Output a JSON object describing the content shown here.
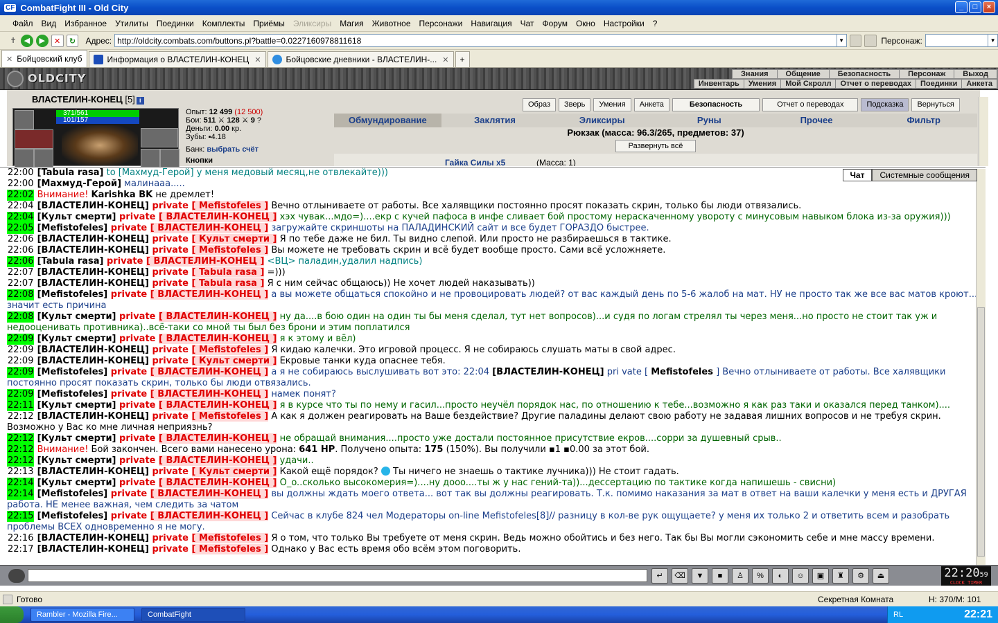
{
  "window": {
    "title": "CombatFight III - Old City",
    "icon": "CF"
  },
  "menu": [
    "Файл",
    "Вид",
    "Избранное",
    "Утилиты",
    "Поединки",
    "Комплекты",
    "Приёмы",
    "Эликсиры",
    "Магия",
    "Животное",
    "Персонажи",
    "Навигация",
    "Чат",
    "Форум",
    "Окно",
    "Настройки",
    "?"
  ],
  "menu_disabled": "Эликсиры",
  "address": {
    "label": "Адрес:",
    "url": "http://oldcity.combats.com/buttons.pl?battle=0.0227160978811618",
    "char_label": "Персонаж:"
  },
  "tabs": [
    {
      "label": "Бойцовский клуб"
    },
    {
      "label": "Информация о ВЛАСТЕЛИН-КОНЕЦ"
    },
    {
      "label": "Бойцовские дневники - ВЛАСТЕЛИН-..."
    }
  ],
  "game": {
    "logo": "OLDCITY",
    "topnav": [
      "Знания",
      "Общение",
      "Безопасность",
      "Персонаж",
      "Выход"
    ],
    "subnav": [
      "Инвентарь",
      "Умения",
      "Мой Скролл",
      "Отчет о переводах",
      "Поединки",
      "Анкета"
    ]
  },
  "character": {
    "name": "ВЛАСТЕЛИН-КОНЕЦ",
    "level": "[5]",
    "hp": "371/561",
    "mp": "101/157",
    "exp_label": "Опыт:",
    "exp": "12 499",
    "exp_next": "(12 500)",
    "fights_label": "Бои:",
    "fights": "511",
    "fights2": "128",
    "fights3": "9",
    "money_label": "Деньги:",
    "money": "0.00",
    "money_unit": "кр.",
    "teeth_label": "Зубы:",
    "teeth": "4.18",
    "bank_label": "Банк:",
    "bank_link": "выбрать счёт",
    "cut_label": "Кнопки"
  },
  "charbuttons": [
    "Образ",
    "Зверь",
    "Умения",
    "Анкета",
    "Безопасность",
    "Отчет о переводах",
    "Подсказка",
    "Вернуться"
  ],
  "invtabs": [
    "Обмундирование",
    "Заклятия",
    "Эликсиры",
    "Руны",
    "Прочее",
    "Фильтр"
  ],
  "backpack": "Рюкзак (масса: 96.3/265, предметов: 37)",
  "expand": "Развернуть всё",
  "item": {
    "name": "Гайка Силы",
    "count": "x5",
    "mass": "(Масса: 1)"
  },
  "chat_tabs": [
    "Чат",
    "Системные сообщения"
  ],
  "chat": [
    {
      "t": "22:00",
      "hl": false,
      "parts": [
        [
          "n",
          "[Tabula rasa]"
        ],
        [
          "to",
          " to [Махмуд-Герой] у меня медовый месяц,не отвлекайте)))"
        ]
      ]
    },
    {
      "t": "22:00",
      "hl": false,
      "parts": [
        [
          "n",
          "[Махмуд-Герой]"
        ],
        [
          "b",
          " малинааа....."
        ]
      ]
    },
    {
      "t": "22:02",
      "hl": true,
      "parts": [
        [
          "w",
          " Внимание! "
        ],
        [
          "n",
          "Karishka BK"
        ],
        [
          "x",
          " не дремлет!"
        ]
      ]
    },
    {
      "t": "22:04",
      "hl": false,
      "parts": [
        [
          "n",
          "[ВЛАСТЕЛИН-КОНЕЦ]"
        ],
        [
          "p",
          " private "
        ],
        [
          "pn",
          "[ Mefistofeles ]"
        ],
        [
          "x",
          " Вечно отлыниваете от работы. Все халявщики постоянно просят показать скрин, только бы люди отвязались."
        ]
      ]
    },
    {
      "t": "22:04",
      "hl": true,
      "parts": [
        [
          "n",
          "[Культ смерти]"
        ],
        [
          "p",
          " private "
        ],
        [
          "pn",
          "[ ВЛАСТЕЛИН-КОНЕЦ ]"
        ],
        [
          "g",
          " хэх чувак...мдо=)....екр с кучей пафоса в инфе сливает бой простому нераскаченному увороту с минусовым навыком блока из-за оружия)))"
        ]
      ]
    },
    {
      "t": "22:05",
      "hl": true,
      "parts": [
        [
          "n",
          "[Mefistofeles]"
        ],
        [
          "p",
          " private "
        ],
        [
          "pn",
          "[ ВЛАСТЕЛИН-КОНЕЦ ]"
        ],
        [
          "b",
          " загружайте скриншоты на ПАЛАДИНСКИЙ сайт и все будет ГОРАЗДО быстрее."
        ]
      ]
    },
    {
      "t": "22:06",
      "hl": false,
      "parts": [
        [
          "n",
          "[ВЛАСТЕЛИН-КОНЕЦ]"
        ],
        [
          "p",
          " private "
        ],
        [
          "pn",
          "[ Культ смерти ]"
        ],
        [
          "x",
          " Я по тебе даже не бил. Ты видно слепой. Или просто не разбираешься в тактике."
        ]
      ]
    },
    {
      "t": "22:06",
      "hl": false,
      "parts": [
        [
          "n",
          "[ВЛАСТЕЛИН-КОНЕЦ]"
        ],
        [
          "p",
          " private "
        ],
        [
          "pn",
          "[ Mefistofeles ]"
        ],
        [
          "x",
          " Вы можете не требовать скрин и всё будет вообще просто. Сами всё усложняете."
        ]
      ]
    },
    {
      "t": "22:06",
      "hl": true,
      "parts": [
        [
          "n",
          "[Tabula rasa]"
        ],
        [
          "p",
          " private "
        ],
        [
          "pn",
          "[ ВЛАСТЕЛИН-КОНЕЦ ]"
        ],
        [
          "to",
          " <ВЦ> паладин,удалил надпись)"
        ]
      ]
    },
    {
      "t": "22:07",
      "hl": false,
      "parts": [
        [
          "n",
          "[ВЛАСТЕЛИН-КОНЕЦ]"
        ],
        [
          "p",
          " private "
        ],
        [
          "pn",
          "[ Tabula rasa ]"
        ],
        [
          "x",
          " =)))"
        ]
      ]
    },
    {
      "t": "22:07",
      "hl": false,
      "parts": [
        [
          "n",
          "[ВЛАСТЕЛИН-КОНЕЦ]"
        ],
        [
          "p",
          " private "
        ],
        [
          "pn",
          "[ Tabula rasa ]"
        ],
        [
          "x",
          " Я с ним сейчас общаюсь)) Не хочет людей наказывать))"
        ]
      ]
    },
    {
      "t": "22:08",
      "hl": true,
      "parts": [
        [
          "n",
          "[Mefistofeles]"
        ],
        [
          "p",
          " private "
        ],
        [
          "pn",
          "[ ВЛАСТЕЛИН-КОНЕЦ ]"
        ],
        [
          "b",
          " а вы можете общаться спокойно и не провоцировать людей? от вас каждый день по 5-6 жалоб на мат. НУ не просто так же все вас матов кроют... значит есть причина"
        ]
      ]
    },
    {
      "t": "22:08",
      "hl": true,
      "parts": [
        [
          "n",
          "[Культ смерти]"
        ],
        [
          "p",
          " private "
        ],
        [
          "pn",
          "[ ВЛАСТЕЛИН-КОНЕЦ ]"
        ],
        [
          "g",
          " ну да....в бою один на один ты бы меня сделал, тут нет вопросов)...и судя по логам стрелял ты через меня...но просто не стоит так уж и недооценивать противника)..всё-таки со мной ты был без брони и этим поплатился"
        ]
      ]
    },
    {
      "t": "22:09",
      "hl": true,
      "parts": [
        [
          "n",
          "[Культ смерти]"
        ],
        [
          "p",
          " private "
        ],
        [
          "pn",
          "[ ВЛАСТЕЛИН-КОНЕЦ ]"
        ],
        [
          "g",
          " я к этому и вёл)"
        ]
      ]
    },
    {
      "t": "22:09",
      "hl": false,
      "parts": [
        [
          "n",
          "[ВЛАСТЕЛИН-КОНЕЦ]"
        ],
        [
          "p",
          " private "
        ],
        [
          "pn",
          "[ Mefistofeles ]"
        ],
        [
          "x",
          " Я кидаю калечки. Это игровой процесс. Я не собираюсь слушать маты в свой адрес."
        ]
      ]
    },
    {
      "t": "22:09",
      "hl": false,
      "parts": [
        [
          "n",
          "[ВЛАСТЕЛИН-КОНЕЦ]"
        ],
        [
          "p",
          " private "
        ],
        [
          "pn",
          "[ Культ смерти ]"
        ],
        [
          "x",
          " Екровые танки куда опаснее тебя."
        ]
      ]
    },
    {
      "t": "22:09",
      "hl": true,
      "parts": [
        [
          "n",
          "[Mefistofeles]"
        ],
        [
          "p",
          " private "
        ],
        [
          "pn",
          "[ ВЛАСТЕЛИН-КОНЕЦ ]"
        ],
        [
          "b",
          " а я не собираюсь выслушивать вот это: 22:04 "
        ],
        [
          "n",
          "[ВЛАСТЕЛИН-КОНЕЦ]"
        ],
        [
          "b",
          " pri vate [ "
        ],
        [
          "n",
          "Mefistofeles"
        ],
        [
          "b",
          " ] Вечно отлыниваете от работы. Все халявщики постоянно просят показать скрин, только бы люди отвязались."
        ]
      ]
    },
    {
      "t": "22:09",
      "hl": true,
      "parts": [
        [
          "n",
          "[Mefistofeles]"
        ],
        [
          "p",
          " private "
        ],
        [
          "pn",
          "[ ВЛАСТЕЛИН-КОНЕЦ ]"
        ],
        [
          "b",
          " намек понят?"
        ]
      ]
    },
    {
      "t": "22:11",
      "hl": true,
      "parts": [
        [
          "n",
          "[Культ смерти]"
        ],
        [
          "p",
          " private "
        ],
        [
          "pn",
          "[ ВЛАСТЕЛИН-КОНЕЦ ]"
        ],
        [
          "g",
          " я в курсе что ты по нему и гасил...просто неучёл порядок нас, по отношению к тебе...возможно я как раз таки и оказался перед танком)...."
        ]
      ]
    },
    {
      "t": "22:12",
      "hl": false,
      "parts": [
        [
          "n",
          "[ВЛАСТЕЛИН-КОНЕЦ]"
        ],
        [
          "p",
          " private "
        ],
        [
          "pn",
          "[ Mefistofeles ]"
        ],
        [
          "x",
          " А как я должен реагировать на Ваше бездействие? Другие паладины делают свою работу не задавая лишних вопросов и не требуя скрин. Возможно у Вас ко мне личная неприязнь?"
        ]
      ]
    },
    {
      "t": "22:12",
      "hl": true,
      "parts": [
        [
          "n",
          "[Культ смерти]"
        ],
        [
          "p",
          " private "
        ],
        [
          "pn",
          "[ ВЛАСТЕЛИН-КОНЕЦ ]"
        ],
        [
          "g",
          " не обращай внимания....просто уже достали постоянное присутствие екров....сорри за душевный срыв.."
        ]
      ]
    },
    {
      "t": "22:12",
      "hl": true,
      "parts": [
        [
          "w",
          " Внимание! "
        ],
        [
          "x",
          "Бой закончен. Всего вами нанесено урона: "
        ],
        [
          "n",
          "641 HP"
        ],
        [
          "x",
          ". Получено опыта: "
        ],
        [
          "n",
          "175"
        ],
        [
          "x",
          " (150%). Вы получили ▪1 ▪0.00 за этот бой."
        ]
      ]
    },
    {
      "t": "22:12",
      "hl": true,
      "parts": [
        [
          "n",
          "[Культ смерти]"
        ],
        [
          "p",
          " private "
        ],
        [
          "pn",
          "[ ВЛАСТЕЛИН-КОНЕЦ ]"
        ],
        [
          "g",
          " удачи.."
        ]
      ]
    },
    {
      "t": "22:13",
      "hl": false,
      "parts": [
        [
          "n",
          "[ВЛАСТЕЛИН-КОНЕЦ]"
        ],
        [
          "p",
          " private "
        ],
        [
          "pn",
          "[ Культ смерти ]"
        ],
        [
          "x",
          " Какой ещё порядок? "
        ],
        [
          "e",
          ""
        ],
        [
          "x",
          " Ты ничего не знаешь о тактике лучника))) Не стоит гадать."
        ]
      ]
    },
    {
      "t": "22:14",
      "hl": true,
      "parts": [
        [
          "n",
          "[Культ смерти]"
        ],
        [
          "p",
          " private "
        ],
        [
          "pn",
          "[ ВЛАСТЕЛИН-КОНЕЦ ]"
        ],
        [
          "g",
          " O_o..сколько высокомерия=)....ну дooo....ты ж у нас гений-та))...дессертацию по тактике когда напишешь - свисни)"
        ]
      ]
    },
    {
      "t": "22:14",
      "hl": true,
      "parts": [
        [
          "n",
          "[Mefistofeles]"
        ],
        [
          "p",
          " private "
        ],
        [
          "pn",
          "[ ВЛАСТЕЛИН-КОНЕЦ ]"
        ],
        [
          "b",
          " вы должны ждать моего ответа... вот так вы должны реагировать. Т.к. помимо наказания за мат в ответ на ваши калечки у меня есть и ДРУГАЯ работа. НЕ менее важная, чем следить за чатом"
        ]
      ]
    },
    {
      "t": "22:15",
      "hl": true,
      "parts": [
        [
          "n",
          "[Mefistofeles]"
        ],
        [
          "p",
          " private "
        ],
        [
          "pn",
          "[ ВЛАСТЕЛИН-КОНЕЦ ]"
        ],
        [
          "b",
          " Сейчас в клубе 824 чел Модераторы on-line Mefistofeles[8]// разницу в кол-ве рук ощущаете? у меня их только 2 и ответить всем и разобрать проблемы ВСЕХ одновременно я не могу."
        ]
      ]
    },
    {
      "t": "22:16",
      "hl": false,
      "parts": [
        [
          "n",
          "[ВЛАСТЕЛИН-КОНЕЦ]"
        ],
        [
          "p",
          " private "
        ],
        [
          "pn",
          "[ Mefistofeles ]"
        ],
        [
          "x",
          " Я о том, что только Вы требуете от меня скрин. Ведь можно обойтись и без него. Так бы Вы могли сэкономить себе и мне массу времени."
        ]
      ]
    },
    {
      "t": "22:17",
      "hl": false,
      "parts": [
        [
          "n",
          "[ВЛАСТЕЛИН-КОНЕЦ]"
        ],
        [
          "p",
          " private "
        ],
        [
          "pn",
          "[ Mefistofeles ]"
        ],
        [
          "x",
          " Однако у Вас есть время обо всём этом поговорить."
        ]
      ]
    }
  ],
  "clock": {
    "time": "22:20",
    "sec": "59",
    "sub": "CLOCK TIMER"
  },
  "status": {
    "text": "Готово",
    "room": "Секретная Комната",
    "coords": "Н: 370/М: 101"
  },
  "taskbar": {
    "tasks": [
      "Rambler - Mozilla Fire...",
      "CombatFight"
    ],
    "lang": "RL",
    "time": "22:21"
  },
  "colors": {
    "highlight": "#00ff00",
    "private": "#e00000",
    "nick_bg": "#ffd8d8",
    "green_msg": "#006400",
    "blue_msg": "#1b3f8a"
  }
}
